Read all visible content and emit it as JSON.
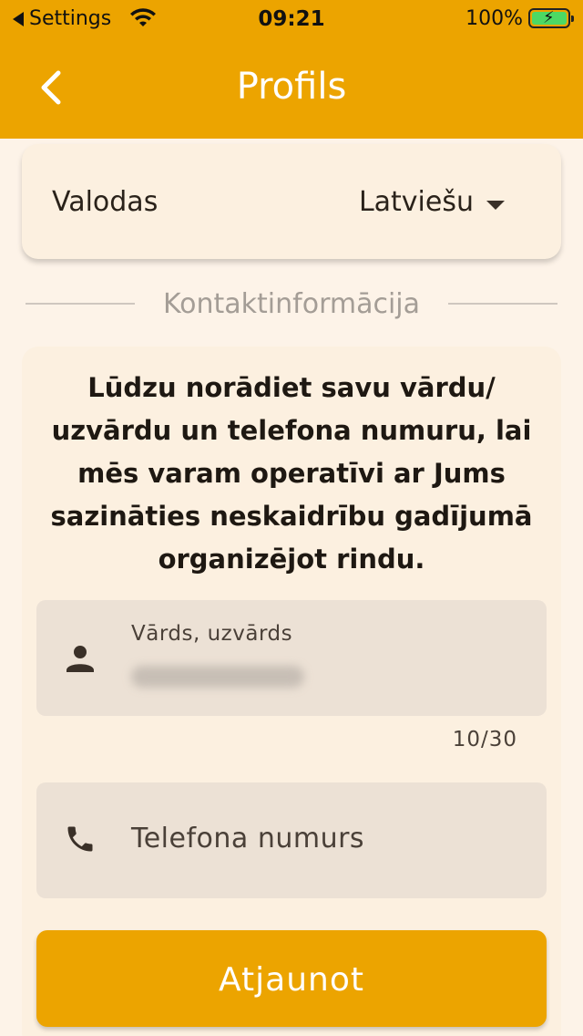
{
  "status_bar": {
    "back_app_label": "Settings",
    "time": "09:21",
    "battery_pct": "100%"
  },
  "header": {
    "title": "Profils",
    "background_color": "#eca400"
  },
  "language": {
    "label": "Valodas",
    "selected": "Latviešu"
  },
  "section": {
    "divider_label": "Kontaktinformācija"
  },
  "contact": {
    "notice": "Lūdzu norādiet savu vārdu/ uzvārdu un telefona numuru, lai mēs varam operatīvi ar Jums sazināties neskaidrību gadījumā organizējot rindu.",
    "name_field": {
      "label": "Vārds, uzvārds",
      "counter": "10/30",
      "icon": "person-icon"
    },
    "phone_field": {
      "placeholder": "Telefona numurs",
      "icon": "phone-icon"
    },
    "submit_label": "Atjaunot"
  }
}
